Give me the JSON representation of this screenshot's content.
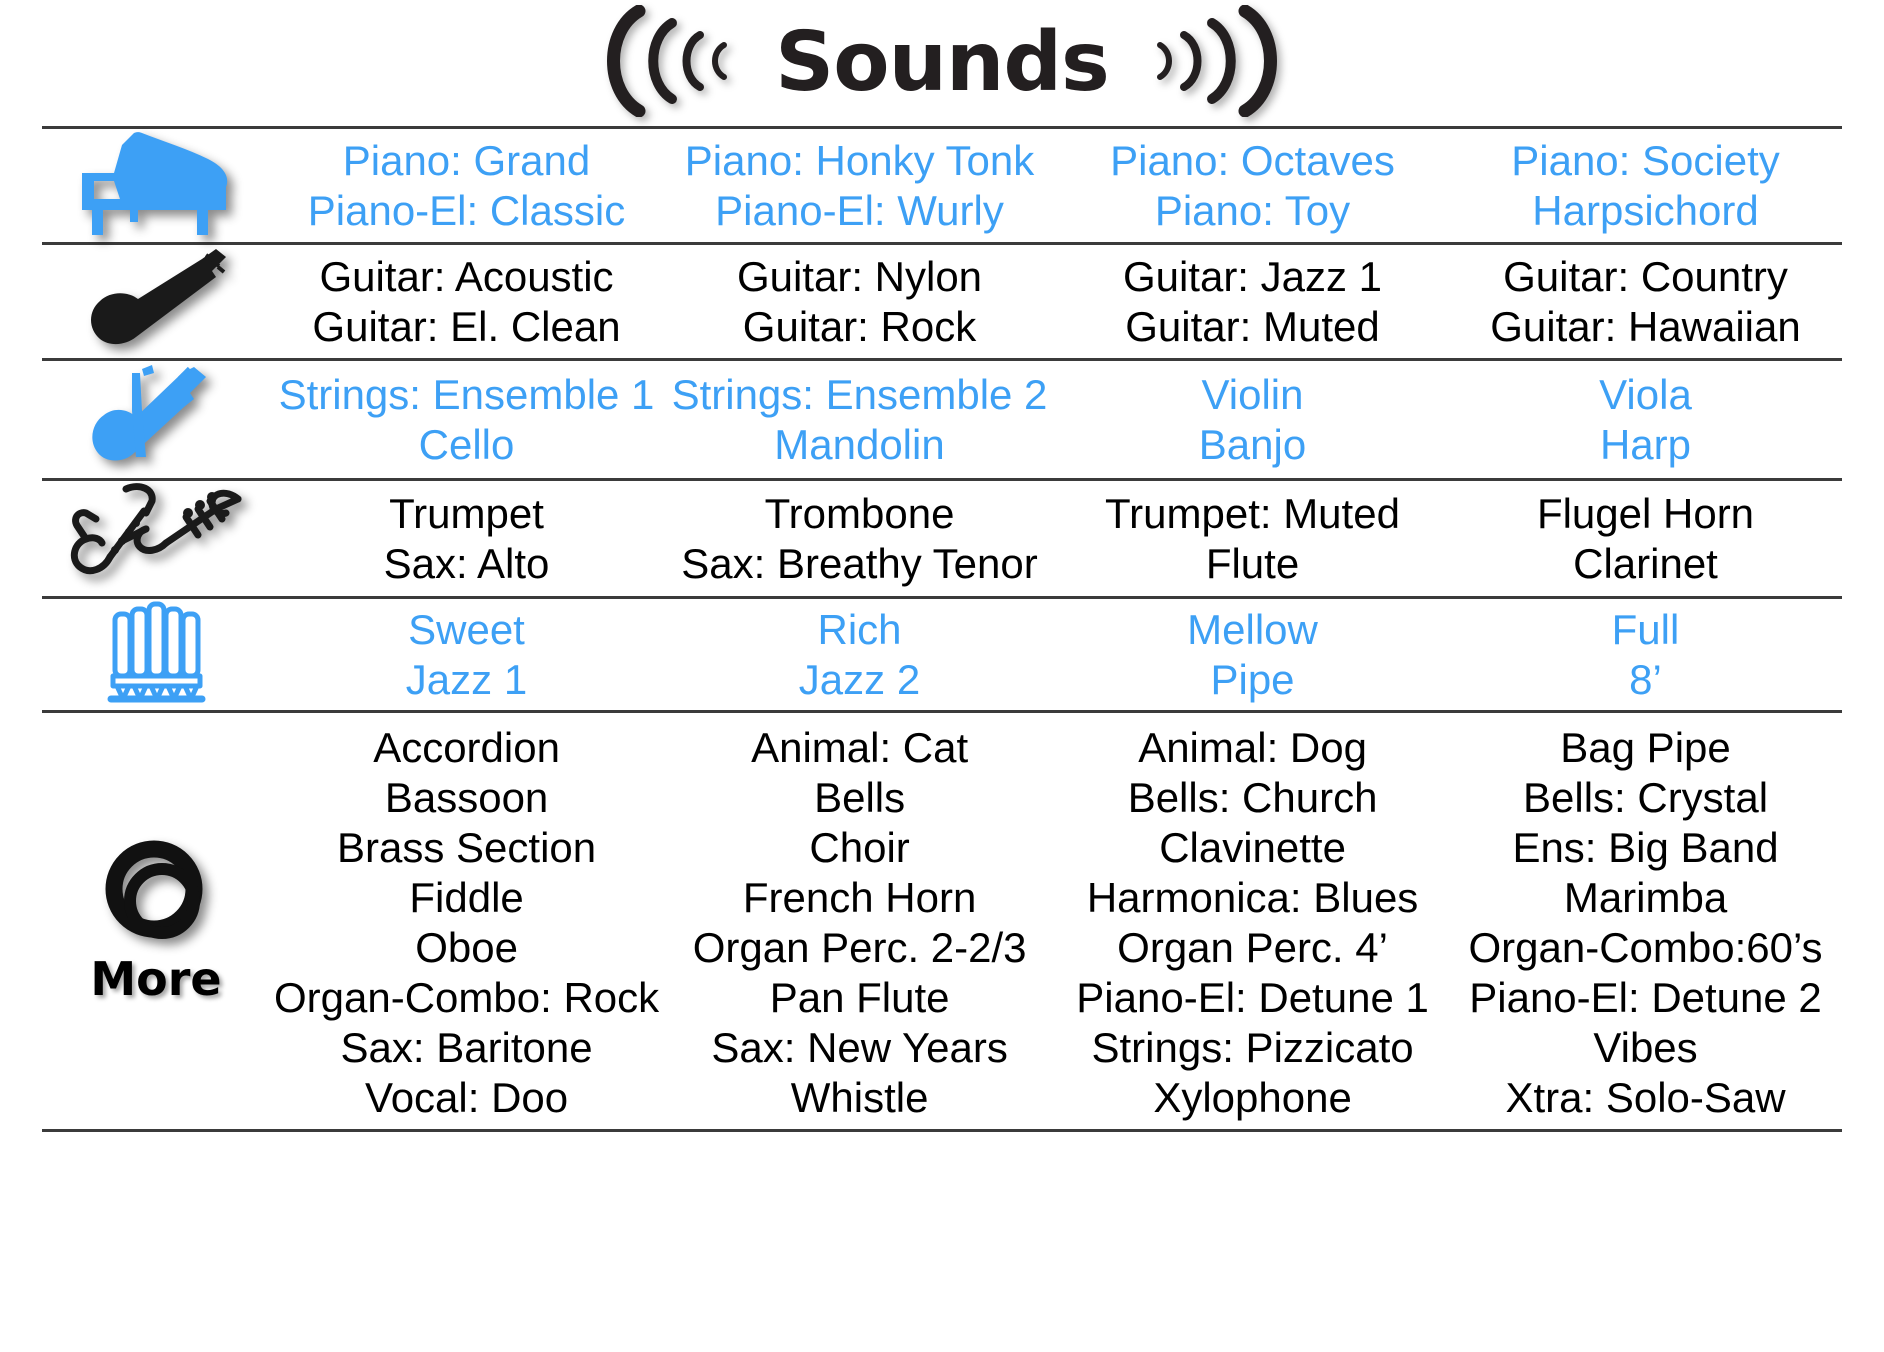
{
  "header": {
    "title": "Sounds",
    "left_icon": "sound-wave-left-icon",
    "right_icon": "sound-wave-right-icon"
  },
  "accent_colors": {
    "blue": "#3da0f5",
    "black": "#000000",
    "rule": "#3b3b3b"
  },
  "more_label": "More",
  "rows": [
    {
      "icon": "grand-piano-icon",
      "icon_color": "#3da0f5",
      "text_color": "blue",
      "columns": [
        [
          "Piano: Grand",
          "Piano-El: Classic"
        ],
        [
          "Piano: Honky Tonk",
          "Piano-El: Wurly"
        ],
        [
          "Piano: Octaves",
          "Piano: Toy"
        ],
        [
          "Piano: Society",
          "Harpsichord"
        ]
      ]
    },
    {
      "icon": "acoustic-guitar-icon",
      "icon_color": "#1a1a1a",
      "text_color": "black",
      "columns": [
        [
          "Guitar: Acoustic",
          "Guitar: El. Clean"
        ],
        [
          "Guitar: Nylon",
          "Guitar: Rock"
        ],
        [
          "Guitar: Jazz 1",
          "Guitar: Muted"
        ],
        [
          "Guitar: Country",
          "Guitar: Hawaiian"
        ]
      ]
    },
    {
      "icon": "violin-icon",
      "icon_color": "#3da0f5",
      "text_color": "blue",
      "columns": [
        [
          "Strings: Ensemble 1",
          "Cello"
        ],
        [
          "Strings: Ensemble 2",
          "Mandolin"
        ],
        [
          "Violin",
          "Banjo"
        ],
        [
          "Viola",
          "Harp"
        ]
      ]
    },
    {
      "icon": "saxophone-trumpet-icon",
      "icon_color": "#1a1a1a",
      "text_color": "black",
      "columns": [
        [
          "Trumpet",
          "Sax: Alto"
        ],
        [
          "Trombone",
          "Sax: Breathy Tenor"
        ],
        [
          "Trumpet: Muted",
          "Flute"
        ],
        [
          "Flugel Horn",
          "Clarinet"
        ]
      ]
    },
    {
      "icon": "organ-pipes-icon",
      "icon_color": "#3da0f5",
      "text_color": "blue",
      "columns": [
        [
          "Sweet",
          "Jazz 1"
        ],
        [
          "Rich",
          "Jazz 2"
        ],
        [
          "Mellow",
          "Pipe"
        ],
        [
          "Full",
          "8’"
        ]
      ]
    },
    {
      "icon": "more-rings-icon",
      "icon_color": "#111111",
      "text_color": "black",
      "is_more": true,
      "columns": [
        [
          "Accordion",
          "Bassoon",
          "Brass Section",
          "Fiddle",
          "Oboe",
          "Organ-Combo: Rock",
          "Sax: Baritone",
          "Vocal: Doo"
        ],
        [
          "Animal: Cat",
          "Bells",
          "Choir",
          "French Horn",
          "Organ Perc. 2-2/3",
          "Pan Flute",
          "Sax: New Years",
          "Whistle"
        ],
        [
          "Animal: Dog",
          "Bells: Church",
          "Clavinette",
          "Harmonica: Blues",
          "Organ Perc. 4’",
          "Piano-El: Detune 1",
          "Strings: Pizzicato",
          "Xylophone"
        ],
        [
          "Bag Pipe",
          "Bells: Crystal",
          "Ens: Big Band",
          "Marimba",
          "Organ-Combo:60’s",
          "Piano-El: Detune 2",
          "Vibes",
          "Xtra: Solo-Saw"
        ]
      ]
    }
  ]
}
